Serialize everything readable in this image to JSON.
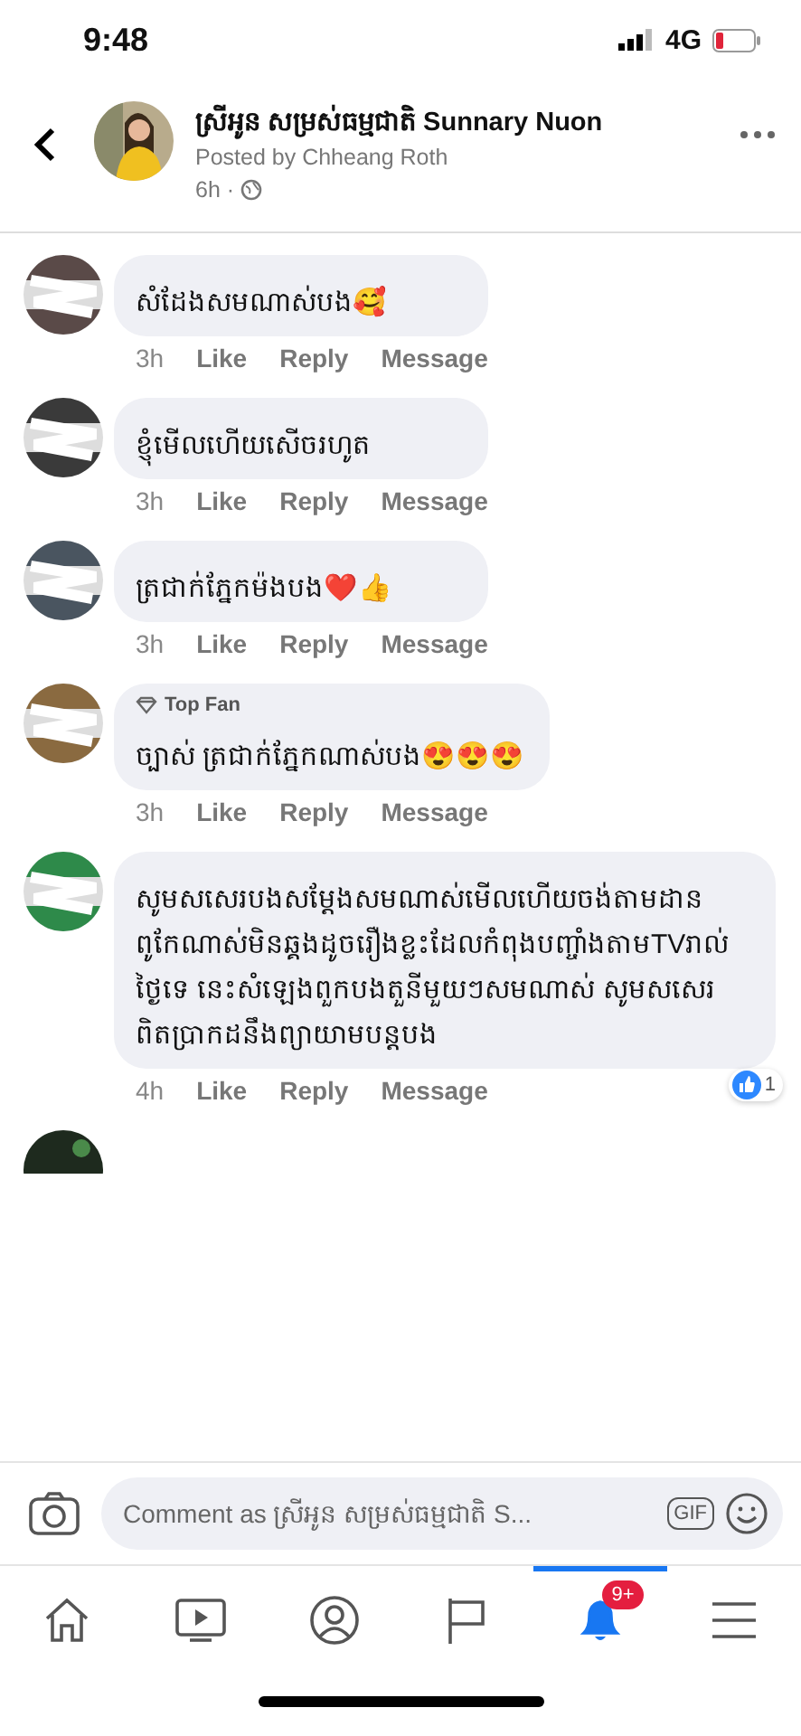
{
  "status_bar": {
    "time": "9:48",
    "network": "4G"
  },
  "header": {
    "page_name": "ស្រីអូន សម្រស់ធម្មជាតិ Sunnary Nuon",
    "posted_by": "Posted by Chheang Roth",
    "time": "6h ·"
  },
  "comments": [
    {
      "text": "សំដែងសមណាស់បង🥰",
      "time": "3h",
      "actions": [
        "Like",
        "Reply",
        "Message"
      ]
    },
    {
      "text": "ខ្ញុំមើលហើយសើចរហូត",
      "time": "3h",
      "actions": [
        "Like",
        "Reply",
        "Message"
      ]
    },
    {
      "text": "ត្រជាក់ភ្នែកម៉ងបង❤️👍",
      "time": "3h",
      "actions": [
        "Like",
        "Reply",
        "Message"
      ]
    },
    {
      "badge": "Top Fan",
      "text": "ច្បាស់ ត្រជាក់ភ្នែកណាស់បង😍😍😍",
      "time": "3h",
      "actions": [
        "Like",
        "Reply",
        "Message"
      ]
    },
    {
      "text": "សូមសសេរបងសម្ដែងសមណាស់មើលហើយចង់តាមដាន ពូកែណាស់មិនឆ្គងដូចរឿងខ្លះដែលកំពុងបញ្ចាំងតាមTVរាល់ថ្ងៃទេ នេះសំឡេងពួកបងតួនីមួយៗសមណាស់ សូមសសេរពិតប្រាកដនឹងព្យាយាមបន្តបង",
      "time": "4h",
      "actions": [
        "Like",
        "Reply",
        "Message"
      ],
      "reactions": "1"
    }
  ],
  "composer": {
    "placeholder": "Comment as ស្រីអូន សម្រស់ធម្មជាតិ S...",
    "gif": "GIF"
  },
  "tabs": [
    {
      "kind": "home",
      "selected": false
    },
    {
      "kind": "watch",
      "selected": false
    },
    {
      "kind": "profile",
      "selected": false
    },
    {
      "kind": "pages",
      "selected": false
    },
    {
      "kind": "notifications",
      "selected": true,
      "count": "9+"
    },
    {
      "kind": "menu",
      "selected": false
    }
  ]
}
